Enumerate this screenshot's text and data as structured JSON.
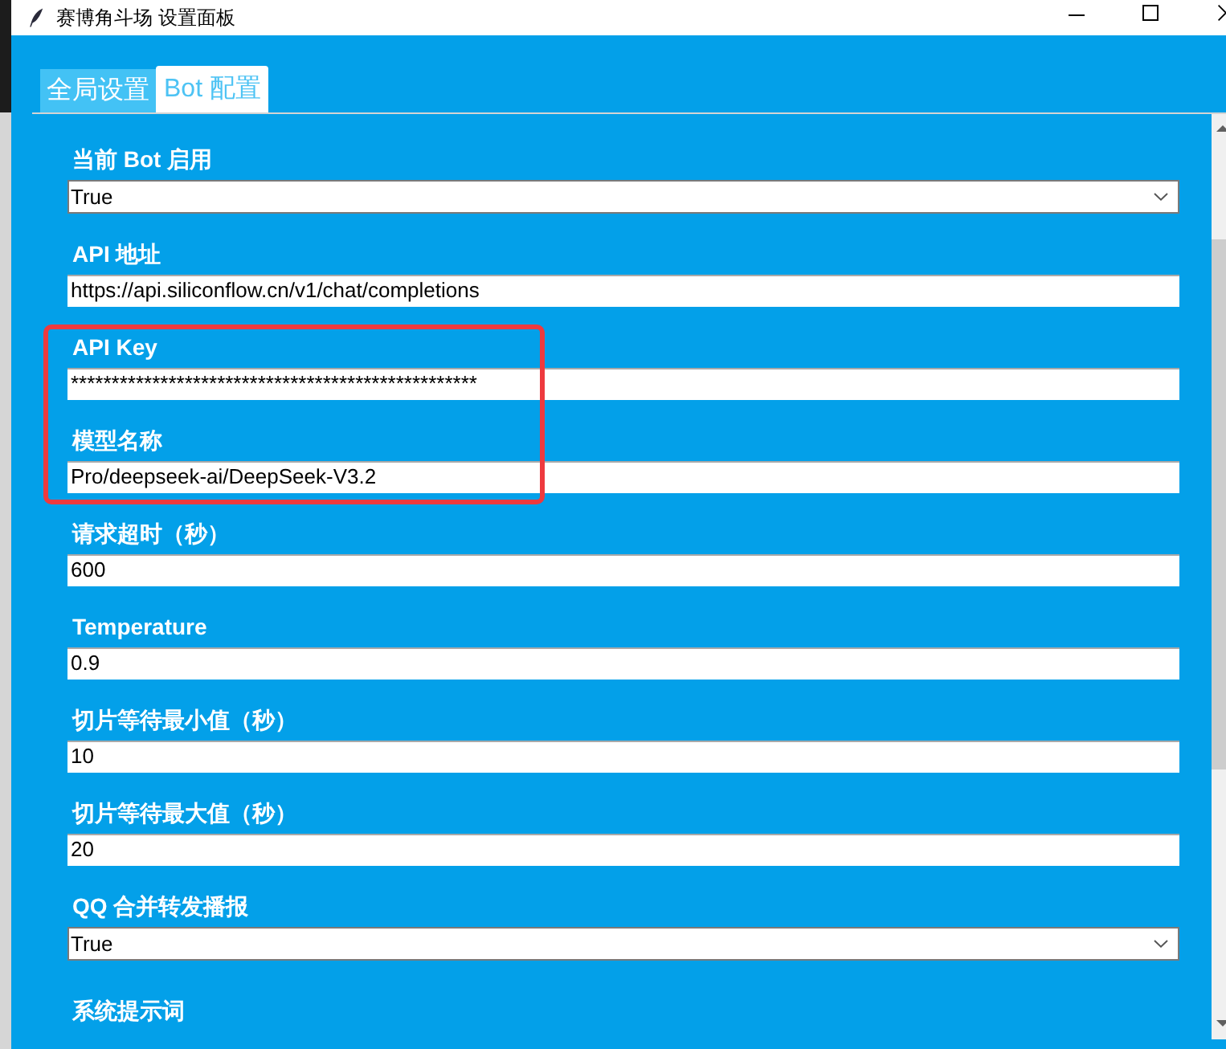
{
  "window": {
    "title": "赛博角斗场 设置面板"
  },
  "tabs": [
    {
      "label": "全局设置",
      "selected": false
    },
    {
      "label": "Bot 配置",
      "selected": true
    }
  ],
  "fields": [
    {
      "label": "当前 Bot 启用",
      "kind": "dropdown",
      "value": "True",
      "highlighted": false
    },
    {
      "label": "API 地址",
      "kind": "text",
      "value": "https://api.siliconflow.cn/v1/chat/completions",
      "highlighted": false
    },
    {
      "label": "API Key",
      "kind": "text",
      "value": "**************************************************",
      "highlighted": true
    },
    {
      "label": "模型名称",
      "kind": "text",
      "value": "Pro/deepseek-ai/DeepSeek-V3.2",
      "highlighted": true
    },
    {
      "label": "请求超时（秒）",
      "kind": "text",
      "value": "600",
      "highlighted": false
    },
    {
      "label": "Temperature",
      "kind": "text",
      "value": "0.9",
      "highlighted": false
    },
    {
      "label": "切片等待最小值（秒）",
      "kind": "text",
      "value": "10",
      "highlighted": false
    },
    {
      "label": "切片等待最大值（秒）",
      "kind": "text",
      "value": "20",
      "highlighted": false
    },
    {
      "label": "QQ 合并转发播报",
      "kind": "dropdown",
      "value": "True",
      "highlighted": false
    },
    {
      "label": "系统提示词",
      "highlighted": false
    }
  ]
}
